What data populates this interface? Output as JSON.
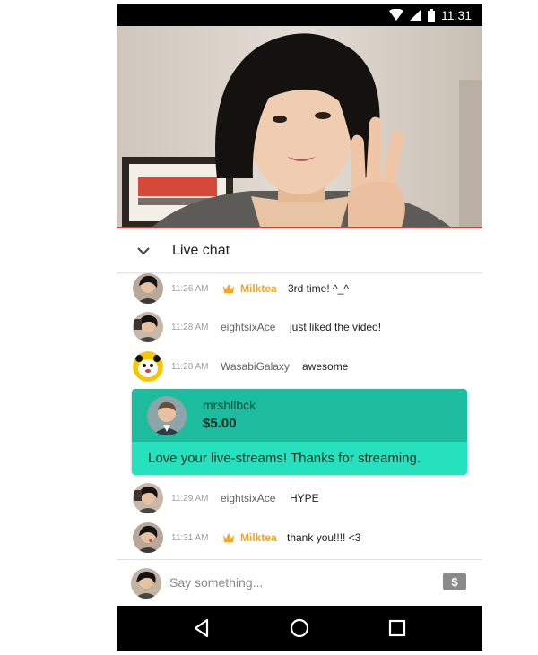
{
  "status_bar": {
    "time": "11:31"
  },
  "chat_header": {
    "title": "Live chat"
  },
  "messages": [
    {
      "time": "11:26 AM",
      "author": "Milktea",
      "member": true,
      "text": "3rd time! ^_^"
    },
    {
      "time": "11:28 AM",
      "author": "eightsixAce",
      "member": false,
      "text": "just liked the video!"
    },
    {
      "time": "11:28 AM",
      "author": "WasabiGalaxy",
      "member": false,
      "text": "awesome"
    },
    {
      "time": "11:29 AM",
      "author": "eightsixAce",
      "member": false,
      "text": "HYPE"
    },
    {
      "time": "11:31 AM",
      "author": "Milktea",
      "member": true,
      "text": "thank you!!!! <3"
    }
  ],
  "super_chat": {
    "author": "mrshllbck",
    "amount": "$5.00",
    "text": "Love your live-streams! Thanks for streaming."
  },
  "input": {
    "placeholder": "Say something..."
  },
  "money_button": {
    "label": "$"
  },
  "colors": {
    "accent_red": "#e53935",
    "member_gold": "#f5a623",
    "superchat_dark": "#1dbc9f",
    "superchat_light": "#25e1bd"
  }
}
